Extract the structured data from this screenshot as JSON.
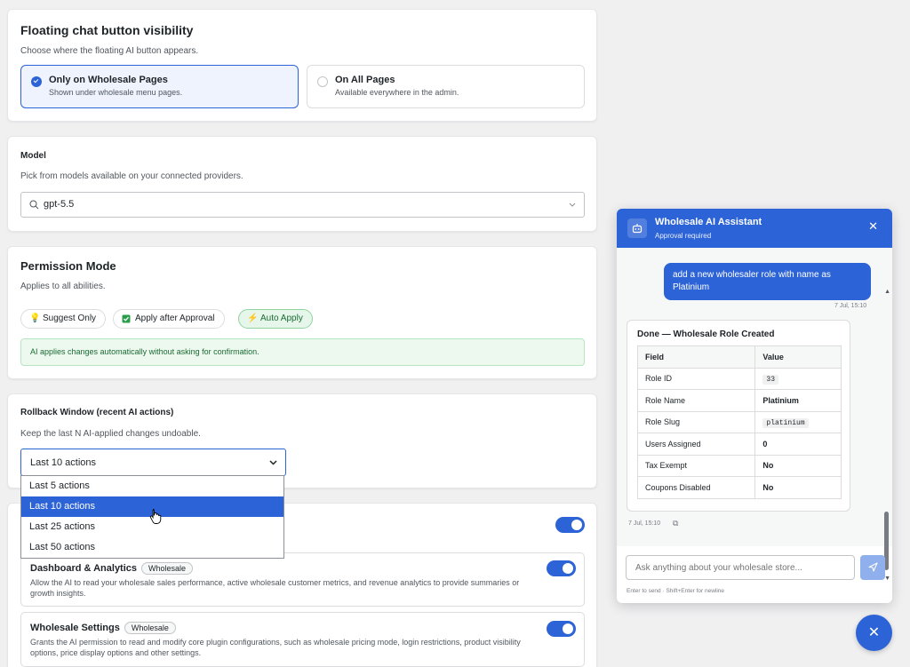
{
  "floating": {
    "title": "Floating chat button visibility",
    "description": "Choose where the floating AI button appears.",
    "options": [
      {
        "label": "Only on Wholesale Pages",
        "sub": "Shown under wholesale menu pages.",
        "selected": true
      },
      {
        "label": "On All Pages",
        "sub": "Available everywhere in the admin.",
        "selected": false
      }
    ]
  },
  "model": {
    "title": "Model",
    "description": "Pick from models available on your connected providers.",
    "value": "gpt-5.5"
  },
  "permission": {
    "title": "Permission Mode",
    "description": "Applies to all abilities.",
    "modes": [
      {
        "label": "Suggest Only",
        "icon": "lightbulb-icon"
      },
      {
        "label": "Apply after Approval",
        "icon": "checkbox-icon"
      },
      {
        "label": "Auto Apply",
        "icon": "lightning-icon",
        "active": true
      }
    ],
    "note": "AI applies changes automatically without asking for confirmation."
  },
  "rollback": {
    "title": "Rollback Window (recent AI actions)",
    "description": "Keep the last N AI-applied changes undoable.",
    "value": "Last 10 actions",
    "options": [
      "Last 5 actions",
      "Last 10 actions",
      "Last 25 actions",
      "Last 50 actions"
    ],
    "highlighted": "Last 10 actions"
  },
  "abilities": [
    {
      "title": "Dashboard & Analytics",
      "badge": "Wholesale",
      "desc": "Allow the AI to read your wholesale sales performance, active wholesale customer metrics, and revenue analytics to provide summaries or growth insights.",
      "enabled": true
    },
    {
      "title": "Wholesale Settings",
      "badge": "Wholesale",
      "desc": "Grants the AI permission to read and modify core plugin configurations, such as wholesale pricing mode, login restrictions, product visibility options, price display options and other settings.",
      "enabled": true
    }
  ],
  "chat": {
    "title": "Wholesale AI Assistant",
    "subtitle": "Approval required",
    "user_message": "add a new wholesaler role with name as Platinium",
    "user_time": "7 Jul, 15:10",
    "reply_title": "Done — Wholesale Role Created",
    "table_headers": [
      "Field",
      "Value"
    ],
    "rows": [
      {
        "field": "Role ID",
        "value": "33",
        "code": true
      },
      {
        "field": "Role Name",
        "value": "Platinium",
        "code": false
      },
      {
        "field": "Role Slug",
        "value": "platinium",
        "code": true
      },
      {
        "field": "Users Assigned",
        "value": "0",
        "code": false
      },
      {
        "field": "Tax Exempt",
        "value": "No",
        "code": false
      },
      {
        "field": "Coupons Disabled",
        "value": "No",
        "code": false
      }
    ],
    "reply_time": "7 Jul, 15:10",
    "input_placeholder": "Ask anything about your wholesale store...",
    "hint": "Enter to send · Shift+Enter for newline"
  },
  "colors": {
    "accent": "#2c63d6",
    "success_bg": "#edf8ef",
    "success_text": "#1a6b33"
  }
}
